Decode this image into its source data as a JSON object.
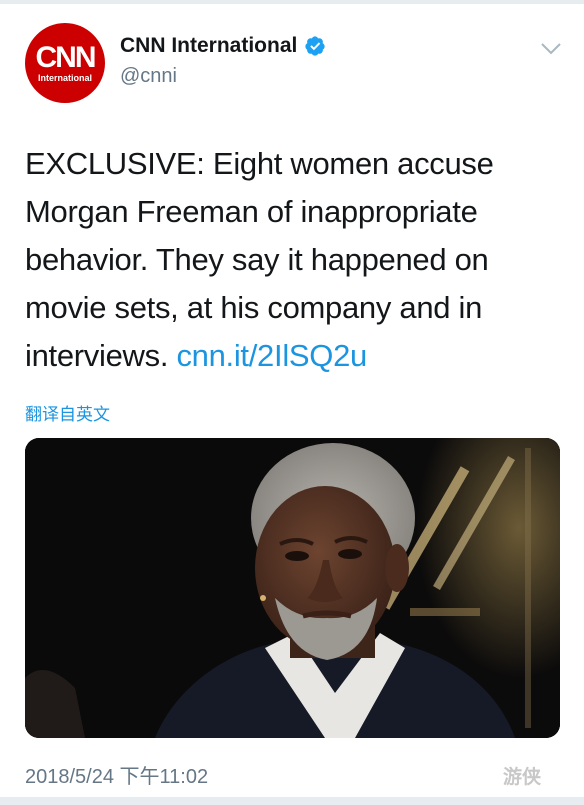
{
  "account": {
    "avatar_logo": "CNN",
    "avatar_sub": "International",
    "display_name": "CNN International",
    "handle": "@cnni",
    "verified": true
  },
  "tweet": {
    "text": "EXCLUSIVE: Eight women accuse Morgan Freeman of inappropriate behavior. They say it happened on movie sets, at his company and in interviews. ",
    "link": "cnn.it/2IlSQ2u",
    "translate_label": "翻译自英文",
    "timestamp": "2018/5/24 下午11:02"
  },
  "watermark": "游侠",
  "icons": {
    "verified": "verified-badge-icon",
    "menu": "chevron-down-icon"
  },
  "colors": {
    "link": "#1b95e0",
    "muted": "#657786",
    "brand": "#cc0000"
  }
}
